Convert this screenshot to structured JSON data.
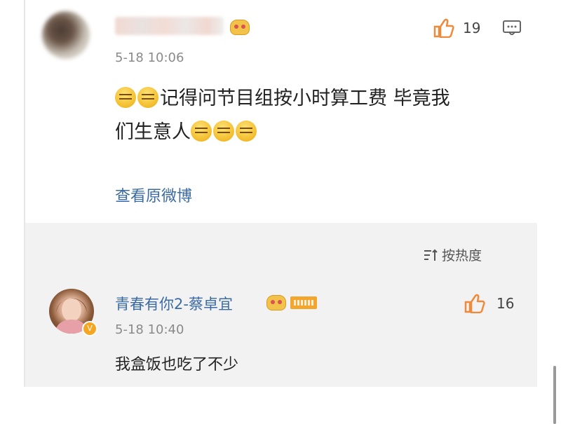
{
  "main_comment": {
    "time": "5-18 10:06",
    "like_count": "19",
    "text_line1": "记得问节目组按小时算工费 毕竟我",
    "text_line2": "们生意人",
    "view_link": "查看原微博"
  },
  "replies_section": {
    "sort_label": "按热度",
    "reply": {
      "username": "青春有你2-蔡卓宜",
      "time": "5-18 10:40",
      "like_count": "16",
      "text": "我盒饭也吃了不少"
    }
  },
  "icons": {
    "like": "thumb-up-icon",
    "comment": "comment-icon",
    "emoji": "grinning-emoji-icon",
    "sort": "sort-icon",
    "badge": "vip-badge-icon"
  },
  "colors": {
    "link_blue": "#3b6ba5",
    "like_orange": "#f08a3b",
    "reply_bg": "#f2f2f2"
  }
}
